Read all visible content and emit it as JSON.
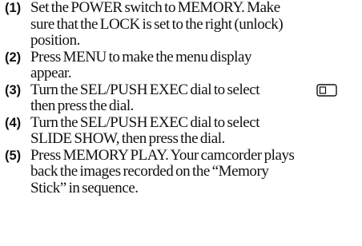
{
  "steps": [
    {
      "number": "(1)",
      "lines": [
        "Set the POWER switch to MEMORY. Make",
        "sure that the LOCK is set to the right (unlock)",
        "position."
      ]
    },
    {
      "number": "(2)",
      "lines": [
        "Press MENU to make the menu display",
        "appear."
      ]
    },
    {
      "number": "(3)",
      "lines": [
        "Turn the SEL/PUSH EXEC dial to select",
        "then press the dial."
      ],
      "icon": "memory-card-menu-icon"
    },
    {
      "number": "(4)",
      "lines": [
        "Turn the SEL/PUSH EXEC dial to select",
        "SLIDE SHOW, then press the dial."
      ]
    },
    {
      "number": "(5)",
      "lines": [
        "Press MEMORY PLAY. Your camcorder plays",
        "back the images recorded on the “Memory",
        "Stick” in sequence."
      ]
    }
  ]
}
